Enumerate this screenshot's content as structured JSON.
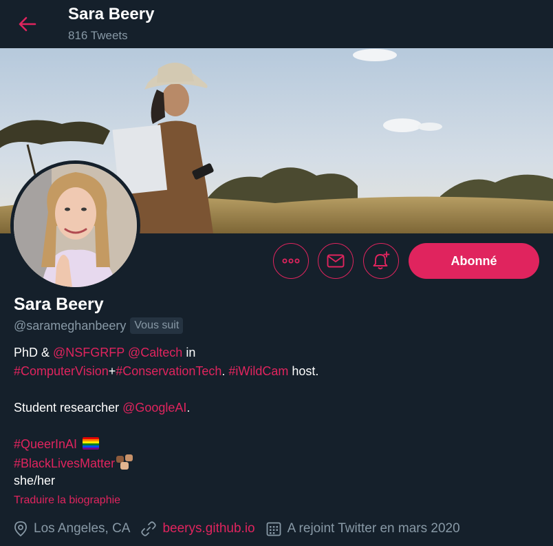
{
  "header": {
    "name": "Sara Beery",
    "tweet_count": "816 Tweets"
  },
  "profile": {
    "name": "Sara Beery",
    "handle": "@sarameghanbeery",
    "follows_you": "Vous suit"
  },
  "actions": {
    "more_icon": "more-icon",
    "message_icon": "message-icon",
    "notifications_icon": "notifications-add-icon",
    "follow_label": "Abonné"
  },
  "bio": {
    "line1": {
      "prefix": "PhD & ",
      "mention1": "@NSFGRFP",
      "space": " ",
      "mention2": "@Caltech",
      "suffix": " in"
    },
    "line2": {
      "tag1": "#ComputerVision",
      "plus": "+",
      "tag2": "#ConservationTech",
      "dot": ". ",
      "tag3": "#iWildCam",
      "suffix": " host."
    },
    "line4": {
      "prefix": "Student researcher ",
      "mention": "@GoogleAI",
      "suffix": "."
    },
    "line6": {
      "tag": "#QueerInAI",
      "emoji": "rainbow-flag-icon"
    },
    "line7": {
      "tag": "#BlackLivesMatter",
      "emoji": "raised-fists-icon"
    },
    "line8": "she/her"
  },
  "translate_label": "Traduire la biographie",
  "meta": {
    "location": "Los Angeles, CA",
    "website": "beerys.github.io",
    "joined": "A rejoint Twitter en mars 2020"
  },
  "colors": {
    "background": "#15202b",
    "accent": "#e0245e",
    "secondary_text": "#8899a6"
  }
}
